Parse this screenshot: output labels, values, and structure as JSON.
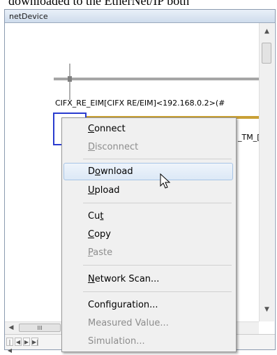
{
  "document": {
    "heading_text": "downloaded to the EtherNet/IP both"
  },
  "window": {
    "title": "netDevice"
  },
  "canvas": {
    "device_label": "CIFX_RE_EIM[CIFX RE/EIM]<192.168.0.2>(#",
    "right_label": "_TM_["
  },
  "context_menu": {
    "items": [
      {
        "label": "Connect",
        "enabled": true,
        "mnemonic": "C"
      },
      {
        "label": "Disconnect",
        "enabled": false,
        "mnemonic": "D"
      },
      {
        "label": "Download",
        "enabled": true,
        "highlighted": true,
        "mnemonic": "o"
      },
      {
        "label": "Upload",
        "enabled": true,
        "mnemonic": "U"
      },
      {
        "label": "Cut",
        "enabled": true,
        "mnemonic": "t"
      },
      {
        "label": "Copy",
        "enabled": true,
        "mnemonic": "C"
      },
      {
        "label": "Paste",
        "enabled": false,
        "mnemonic": "P"
      },
      {
        "label": "Network Scan...",
        "enabled": true,
        "mnemonic": "N"
      },
      {
        "label": "Configuration...",
        "enabled": true
      },
      {
        "label": "Measured Value...",
        "enabled": false
      },
      {
        "label": "Simulation...",
        "enabled": false
      }
    ]
  },
  "scrollbars": {
    "up_arrow": "▲",
    "down_arrow": "▼",
    "left_arrow": "◀",
    "right_arrow": "▶",
    "thumb_grip": "≡",
    "h_thumb_grip": "III"
  },
  "nav_buttons": [
    "|◀",
    "◀",
    "▶",
    "▶|"
  ],
  "colors": {
    "selection_border": "#2a3ccf",
    "bus_orange": "#c9a036",
    "bus_gray": "#a6a6a6",
    "menu_highlight": "#dce8f6"
  }
}
